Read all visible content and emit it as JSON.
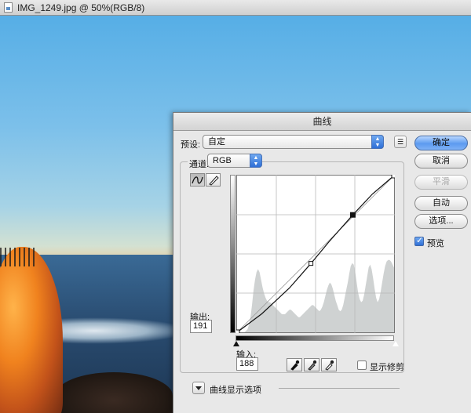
{
  "document": {
    "title": "IMG_1249.jpg @ 50%(RGB/8)"
  },
  "dialog": {
    "title": "曲线",
    "preset_label": "预设:",
    "preset_value": "自定",
    "channel_label": "通道:",
    "channel_value": "RGB",
    "output_label": "输出:",
    "output_value": "191",
    "input_label": "输入:",
    "input_value": "188",
    "show_clipping_label": "显示修剪",
    "show_clipping_checked": false,
    "display_options_label": "曲线显示选项",
    "buttons": {
      "ok": "确定",
      "cancel": "取消",
      "smooth": "平滑",
      "auto": "自动",
      "options": "选项..."
    },
    "preview_label": "预览",
    "preview_checked": true
  },
  "chart_data": {
    "type": "line",
    "title": "",
    "xlabel": "输入",
    "ylabel": "输出",
    "xlim": [
      0,
      255
    ],
    "ylim": [
      0,
      255
    ],
    "grid": true,
    "series": [
      {
        "points": [
          [
            0,
            0
          ],
          [
            40,
            30
          ],
          [
            85,
            72
          ],
          [
            120,
            112
          ],
          [
            150,
            148
          ],
          [
            188,
            191
          ],
          [
            220,
            225
          ],
          [
            255,
            255
          ]
        ]
      }
    ],
    "baseline": [
      [
        0,
        0
      ],
      [
        255,
        255
      ]
    ],
    "control_points": [
      [
        0,
        0
      ],
      [
        188,
        191
      ],
      [
        255,
        255
      ]
    ],
    "selected_point": [
      188,
      191
    ],
    "histogram": [
      0,
      0,
      0,
      0,
      0,
      0,
      2,
      4,
      10,
      20,
      36,
      56,
      70,
      80,
      84,
      80,
      70,
      60,
      52,
      46,
      42,
      40,
      40,
      38,
      36,
      34,
      32,
      30,
      28,
      26,
      24,
      24,
      24,
      26,
      28,
      30,
      30,
      28,
      26,
      24,
      22,
      20,
      20,
      22,
      24,
      26,
      28,
      30,
      32,
      34,
      36,
      36,
      34,
      32,
      30,
      28,
      30,
      34,
      40,
      48,
      56,
      62,
      66,
      64,
      58,
      50,
      42,
      36,
      30,
      28,
      30,
      36,
      46,
      56,
      66,
      78,
      88,
      92,
      90,
      80,
      66,
      52,
      44,
      40,
      42,
      50,
      62,
      74,
      86,
      90,
      84,
      72,
      58,
      46,
      40,
      44,
      54,
      66,
      78,
      88,
      94,
      96,
      96,
      94,
      90,
      86
    ]
  }
}
